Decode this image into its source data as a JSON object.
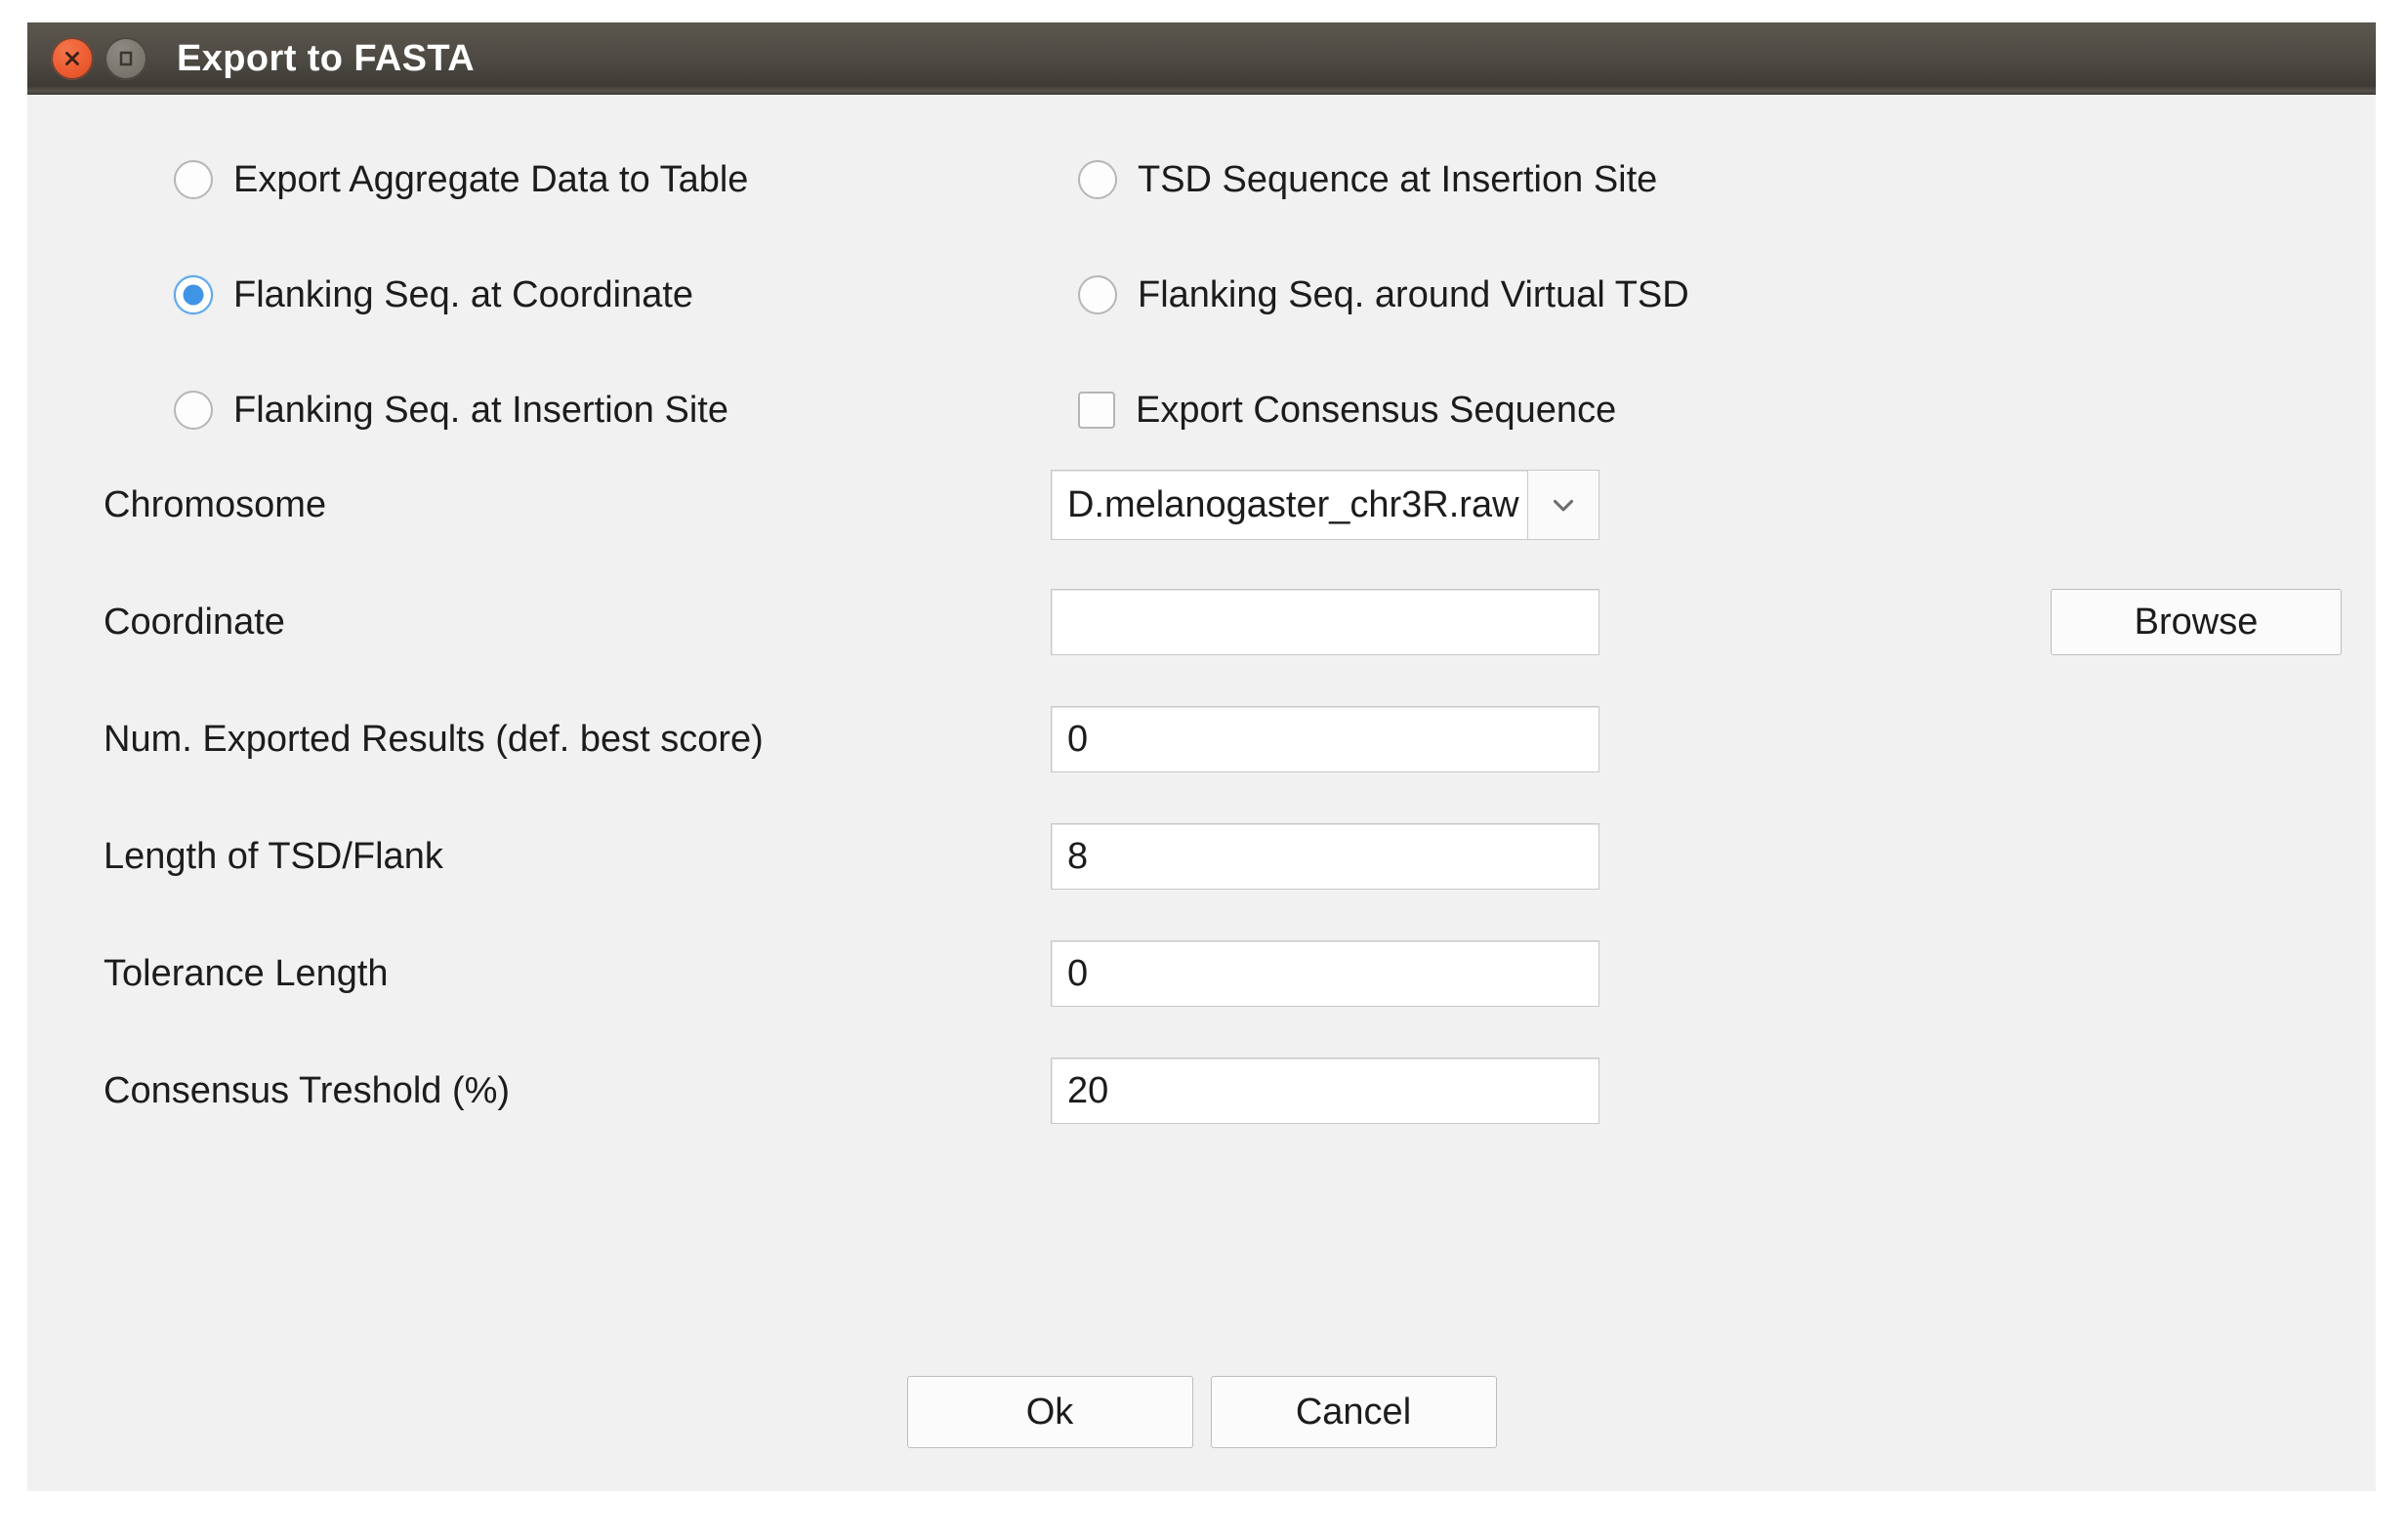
{
  "window": {
    "title": "Export to FASTA",
    "close_icon": "close-icon",
    "maximize_icon": "maximize-icon",
    "titlebar_color": "#45423c",
    "close_button_color": "#ed5b30",
    "body_color": "#f1f1f1"
  },
  "options": {
    "accent_color": "#3f94e6",
    "rows": [
      {
        "left": {
          "type": "radio",
          "label": "Export Aggregate Data to Table",
          "checked": false,
          "name": "radio-export-aggregate-data-to-table"
        },
        "right": {
          "type": "radio",
          "label": "TSD Sequence at Insertion Site",
          "checked": false,
          "name": "radio-tsd-sequence-at-insertion-site"
        }
      },
      {
        "left": {
          "type": "radio",
          "label": "Flanking Seq. at Coordinate",
          "checked": true,
          "name": "radio-flanking-seq-at-coordinate"
        },
        "right": {
          "type": "radio",
          "label": "Flanking Seq. around Virtual TSD",
          "checked": false,
          "name": "radio-flanking-seq-around-virtual-tsd"
        }
      },
      {
        "left": {
          "type": "radio",
          "label": "Flanking Seq. at Insertion Site",
          "checked": false,
          "name": "radio-flanking-seq-at-insertion-site"
        },
        "right": {
          "type": "checkbox",
          "label": "Export Consensus Sequence",
          "checked": false,
          "name": "checkbox-export-consensus-sequence"
        }
      }
    ]
  },
  "form": {
    "chromosome": {
      "label": "Chromosome",
      "value": "D.melanogaster_chr3R.raw",
      "arrow_icon": "chevron-down-icon"
    },
    "coordinate": {
      "label": "Coordinate",
      "value": "",
      "placeholder": "",
      "browse_label": "Browse"
    },
    "num_exported_results": {
      "label": "Num. Exported Results (def. best score)",
      "value": "0"
    },
    "length_of_tsd_flank": {
      "label": "Length of TSD/Flank",
      "value": "8"
    },
    "tolerance_length": {
      "label": "Tolerance Length",
      "value": "0"
    },
    "consensus_threshold": {
      "label": "Consensus Treshold (%)",
      "value": "20"
    }
  },
  "footer": {
    "ok_label": "Ok",
    "cancel_label": "Cancel"
  }
}
